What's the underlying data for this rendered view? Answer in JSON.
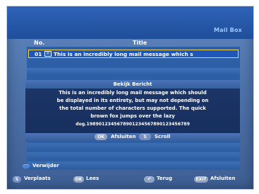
{
  "screen": {
    "title": "Mail Box"
  },
  "table": {
    "headers": {
      "no": "No.",
      "title": "Title"
    }
  },
  "selected_row": {
    "no": "01",
    "icon": "mail-icon",
    "text": "This is an incredibly long mail message which s"
  },
  "dialog": {
    "title": "Bekijk Bericht",
    "lines": [
      "This is an incredibly long mail message which should",
      "be displayed in its entirety, but may not depending on",
      "the total number of characters supported. The quick",
      "brown fox jumps over the lazy",
      "dog.1989012345678901234567890123456789"
    ],
    "footer": {
      "ok_button": "OK",
      "ok_label": "Afsluiten",
      "scroll_label": "Scroll"
    }
  },
  "actions": {
    "delete_label": "Verwijder",
    "move_label": "Verplaats",
    "ok_button": "OK",
    "read_label": "Lees",
    "back_label": "Terug",
    "exit_button": "EXIT",
    "exit_label": "Afsluiten"
  },
  "colors": {
    "screen_bg": "#4f75ad",
    "title_bar": "#1f4e9a",
    "selection_border": "#f2d65a",
    "dialog_body": "#1c3567",
    "accent_text": "#9ec7ff"
  }
}
